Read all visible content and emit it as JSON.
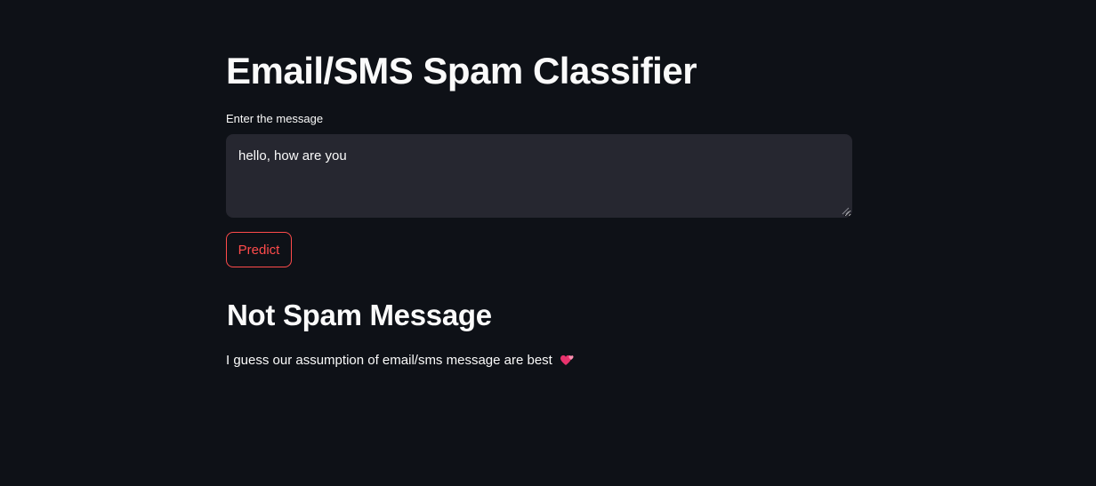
{
  "header": {
    "title": "Email/SMS Spam Classifier"
  },
  "form": {
    "label": "Enter the message",
    "message_value": "hello, how are you",
    "predict_label": "Predict"
  },
  "result": {
    "heading": "Not Spam Message",
    "text": "I guess our assumption of email/sms message are best",
    "emoji_icon": "two-hearts-icon"
  },
  "colors": {
    "background": "#0e1117",
    "input_background": "#262730",
    "accent": "#ff4b4b",
    "text": "#fafafa"
  }
}
